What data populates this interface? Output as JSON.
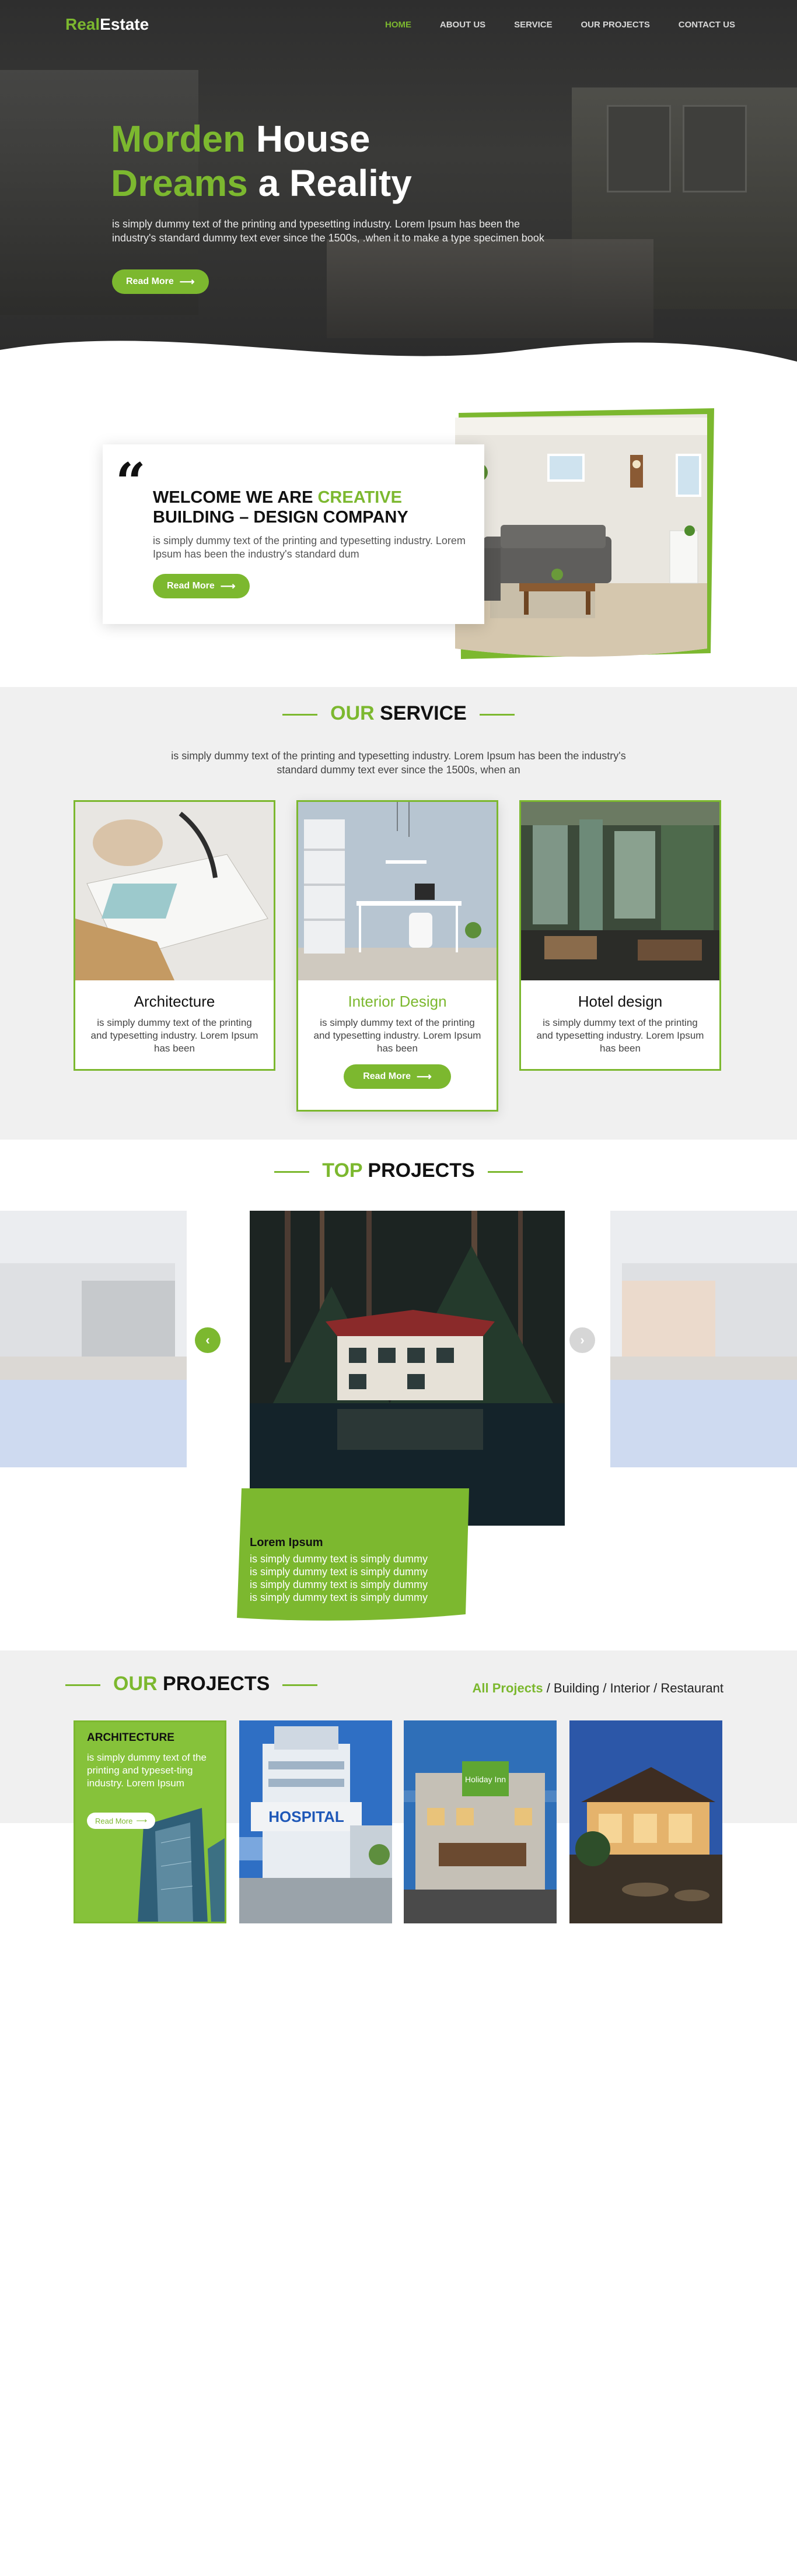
{
  "brand": {
    "part1": "Real",
    "part2": "Estate",
    "accent": "#7cb82f"
  },
  "nav": {
    "items": [
      "HOME",
      "ABOUT US",
      "SERVICE",
      "OUR PROJECTS",
      "CONTACT US"
    ],
    "active": "HOME"
  },
  "hero": {
    "title_g1": "Morden",
    "title_w1": " House",
    "title_g2": "Dreams",
    "title_w2": " a Reality",
    "desc": "is simply dummy text of the printing and typesetting industry. Lorem Ipsum has been the industry's standard dummy text ever since the 1500s, .when  it to make a type specimen book",
    "button": "Read More"
  },
  "welcome": {
    "quote": "“",
    "t1": "WELCOME ",
    "t2": "WE ARE ",
    "t3": "CREATIVE",
    "t4": "BUILDING – DESIGN COMPANY",
    "desc": "is simply dummy text of the printing and typesetting industry. Lorem Ipsum has been the industry's standard dum",
    "button": "Read More"
  },
  "service": {
    "h_green": "OUR",
    "h_bold": "SERVICE",
    "desc": "is simply dummy text of the printing and typesetting industry. Lorem Ipsum has been the industry's standard dummy text ever since the 1500s, when an",
    "cards": [
      {
        "title": "Architecture",
        "desc": "is simply dummy text of the printing and typesetting industry. Lorem Ipsum has been"
      },
      {
        "title": "Interior Design",
        "desc": "is simply dummy text of the printing and typesetting industry. Lorem Ipsum has been",
        "button": "Read More"
      },
      {
        "title": "Hotel design",
        "desc": "is simply dummy text of the printing and typesetting industry. Lorem Ipsum has been"
      }
    ]
  },
  "top_projects": {
    "h_green": "TOP",
    "h_bold": "PROJECTS",
    "card_title": "Lorem Ipsum",
    "card_lines": [
      "is simply dummy text  is simply dummy",
      "is simply dummy text  is simply dummy",
      "is simply dummy text  is simply dummy",
      "is simply dummy text  is simply dummy"
    ],
    "prev_icon": "chevron-left-icon",
    "next_icon": "chevron-right-icon"
  },
  "our_projects": {
    "h_green": "OUR",
    "h_bold": "PROJECTS",
    "filters": [
      "All Projects",
      "Building",
      "Interior",
      "Restaurant"
    ],
    "active_filter": "All Projects",
    "first_card": {
      "title": "ARCHITECTURE",
      "desc": "is simply dummy text of the printing and typeset-ting industry. Lorem Ipsum",
      "button": "Read More"
    },
    "hospital_sign": "HOSPITAL",
    "hotel_sign": "Holiday Inn"
  }
}
